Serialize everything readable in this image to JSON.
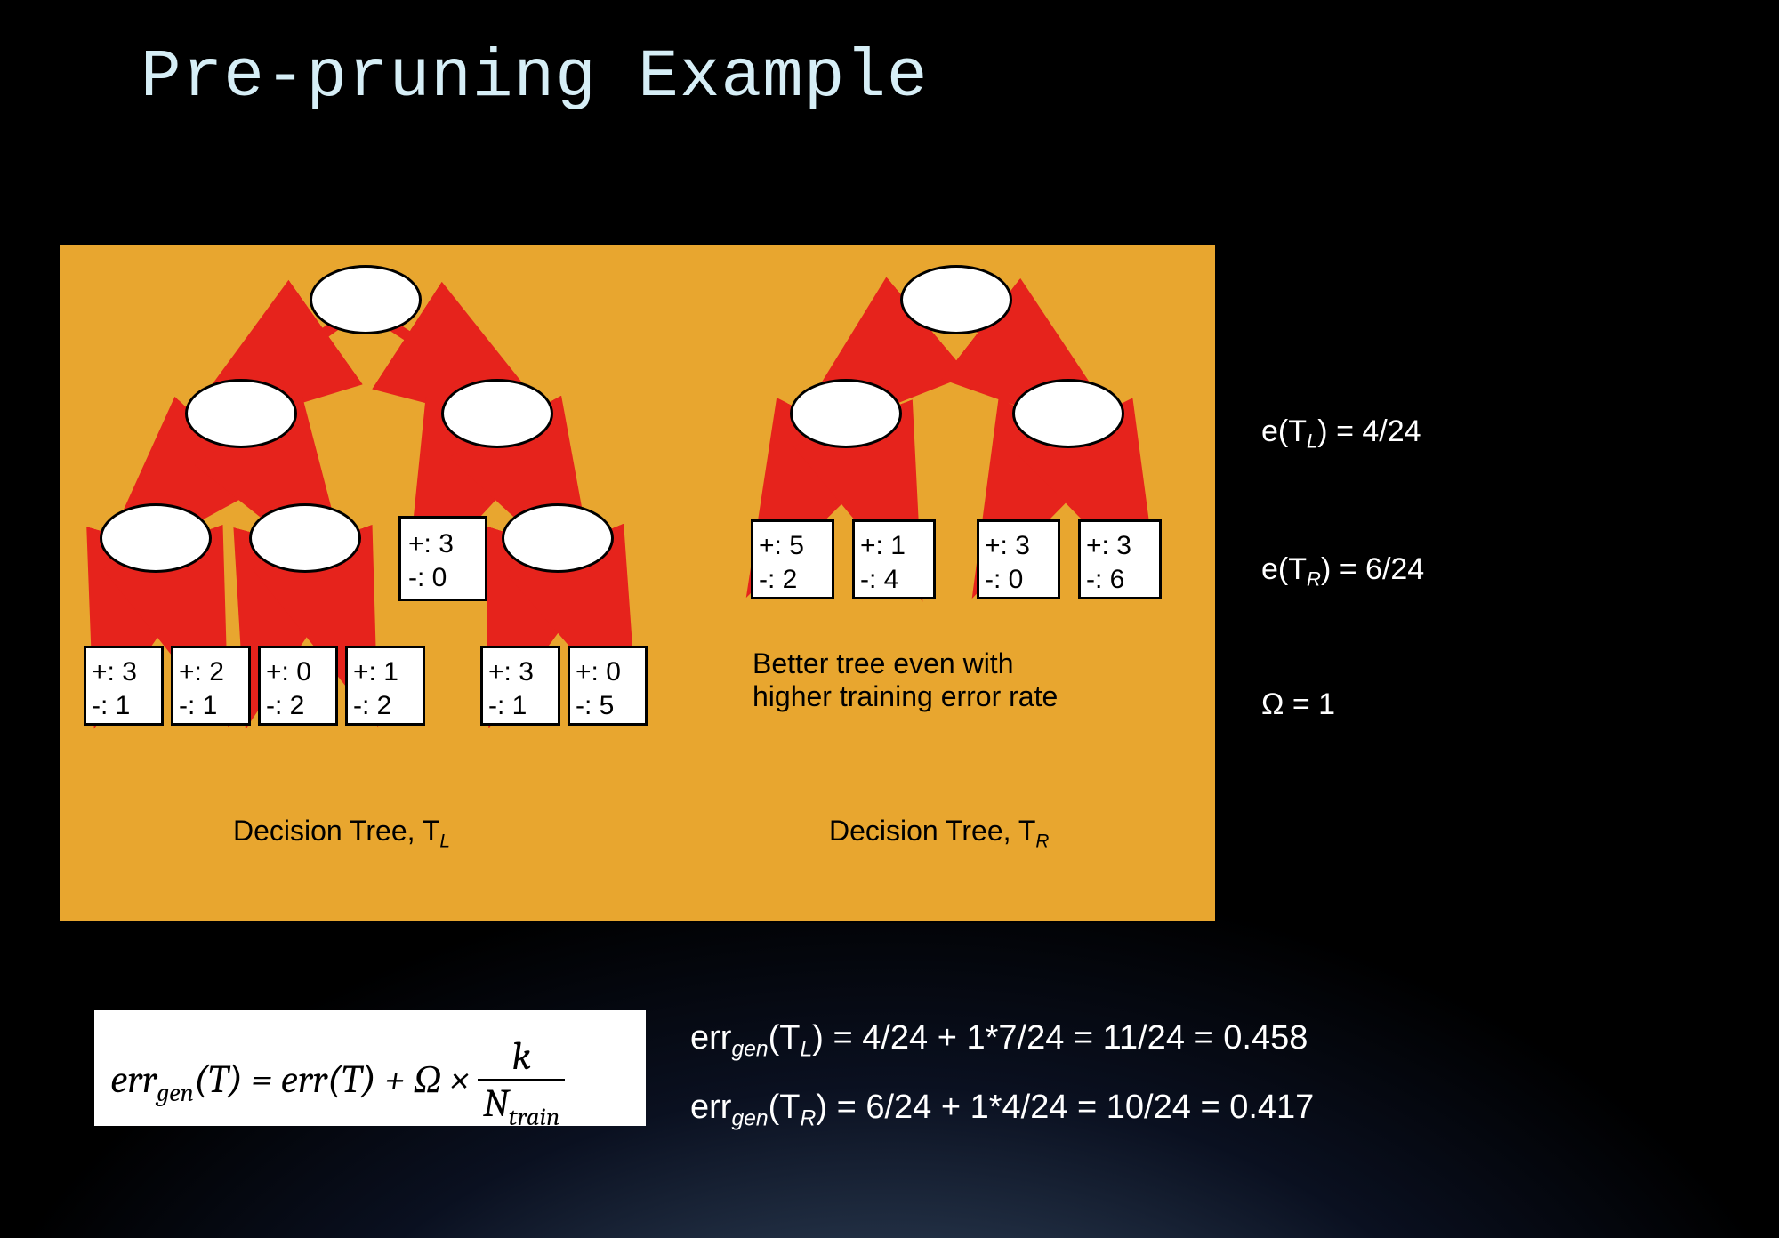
{
  "title": "Pre-pruning Example",
  "panel": {
    "caption_left": "Decision Tree, T",
    "caption_left_sub": "L",
    "caption_right": "Decision Tree, T",
    "caption_right_sub": "R",
    "note_line1": "Better tree even with",
    "note_line2": "higher training error  rate",
    "left_tree_leaves": [
      {
        "p": "+: 3",
        "n": "-: 1"
      },
      {
        "p": "+: 2",
        "n": "-: 1"
      },
      {
        "p": "+: 0",
        "n": "-: 2"
      },
      {
        "p": "+: 1",
        "n": "-: 2"
      },
      {
        "p": "+: 3",
        "n": "-: 1"
      },
      {
        "p": "+: 0",
        "n": "-: 5"
      }
    ],
    "left_tree_mid_leaf": {
      "p": "+: 3",
      "n": "-: 0"
    },
    "right_tree_leaves": [
      {
        "p": "+: 5",
        "n": "-: 2"
      },
      {
        "p": "+: 1",
        "n": "-: 4"
      },
      {
        "p": "+: 3",
        "n": "-: 0"
      },
      {
        "p": "+: 3",
        "n": "-: 6"
      }
    ]
  },
  "side": {
    "e_l_label": "e(T",
    "e_l_sub": "L",
    "e_l_rest": ") = 4/24",
    "e_r_label": "e(T",
    "e_r_sub": "R",
    "e_r_rest": ") = 6/24",
    "omega": "Ω = 1"
  },
  "formula": {
    "lhs": "err",
    "lhs_sub": "gen",
    "mid": "(T) = err(T) + Ω × ",
    "frac_top": "k",
    "frac_bot": "N",
    "frac_bot_sub": "train"
  },
  "equations": {
    "l1_a": "err",
    "l1_sub": "gen",
    "l1_b": "(T",
    "l1_c_sub": "L",
    "l1_d": ") = 4/24 + 1*7/24 = 11/24 = 0.458",
    "l2_a": "err",
    "l2_sub": "gen",
    "l2_b": "(T",
    "l2_c_sub": "R",
    "l2_d": ") = 6/24 + 1*4/24 = 10/24 = 0.417"
  }
}
